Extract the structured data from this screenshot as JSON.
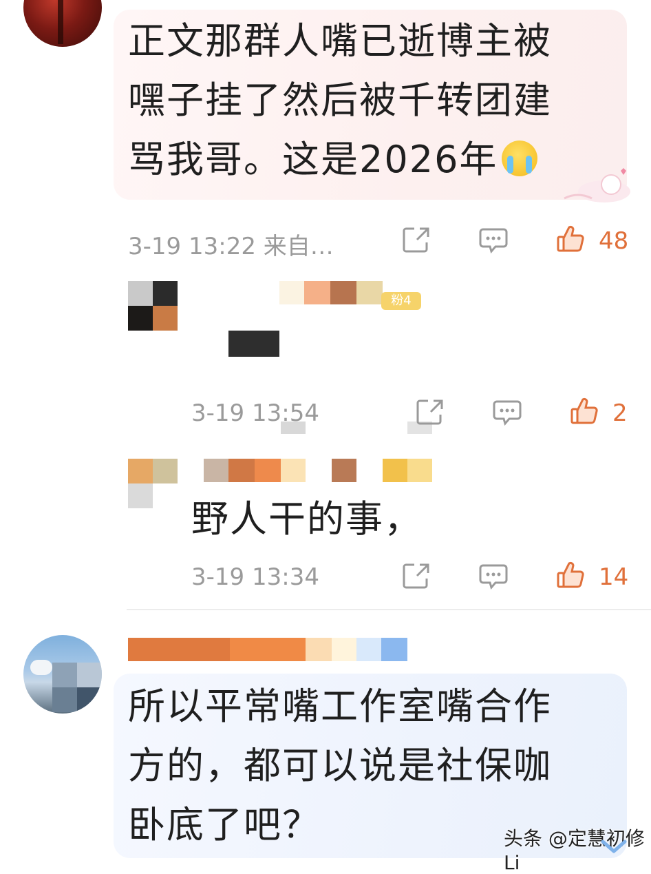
{
  "comment1": {
    "lines": [
      "正文那群人嘴已逝博主被",
      "嘿子挂了然后被千转团建",
      "骂我哥。这是2026年"
    ],
    "emoji": "crying-face-emoji",
    "time": "3-19 13:22 来自…",
    "likes": "48"
  },
  "reply1": {
    "badge": "粉4",
    "time": "3-19 13:54",
    "likes": "2"
  },
  "reply2": {
    "text": "野人干的事，",
    "time": "3-19 13:34",
    "likes": "14"
  },
  "comment2": {
    "lines": [
      "所以平常嘴工作室嘴合作",
      "方的，都可以说是社保咖",
      "卧底了吧？"
    ]
  },
  "watermark": "头条 @定慧初修Li",
  "icons": {
    "share": "share-icon",
    "comment": "comment-icon",
    "like": "thumbs-up-icon"
  },
  "colors": {
    "accent": "#e0703a",
    "meta_gray": "#9a9a9a"
  }
}
